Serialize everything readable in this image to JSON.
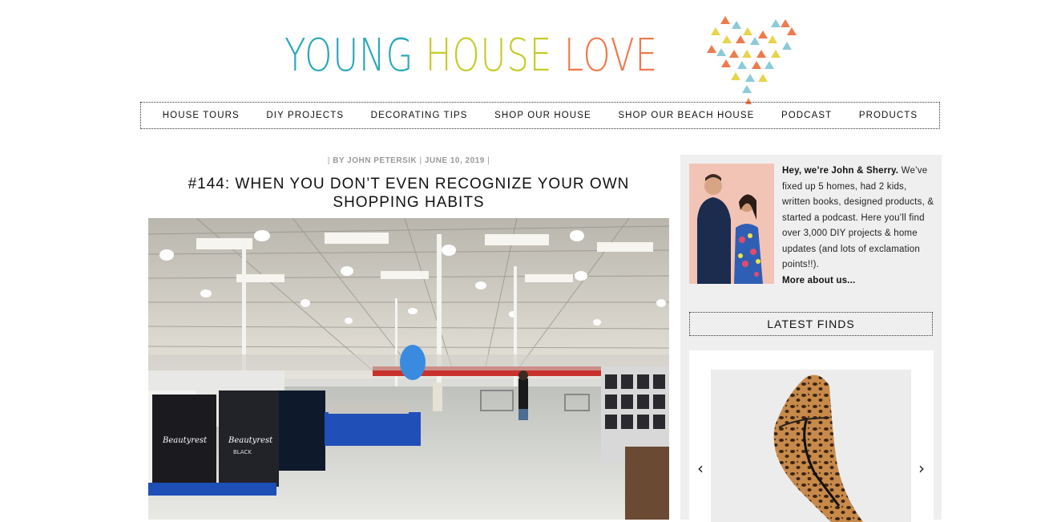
{
  "header": {
    "logo": {
      "word1": "YOUNG",
      "word2": "HOUSE",
      "word3": "LOVE",
      "color1": "#2aa8b8",
      "color2": "#c4cc2a",
      "color3": "#ee7a4d"
    }
  },
  "nav": {
    "items": [
      {
        "label": "HOUSE TOURS"
      },
      {
        "label": "DIY PROJECTS"
      },
      {
        "label": "DECORATING TIPS"
      },
      {
        "label": "SHOP OUR HOUSE"
      },
      {
        "label": "SHOP OUR BEACH HOUSE"
      },
      {
        "label": "PODCAST"
      },
      {
        "label": "PRODUCTS"
      }
    ]
  },
  "post": {
    "separator": "|",
    "author": "BY JOHN PETERSIK",
    "date": "JUNE 10, 2019",
    "title": "#144: WHEN YOU DON’T EVEN RECOGNIZE YOUR OWN SHOPPING HABITS",
    "image_icon": "warehouse-store-photo"
  },
  "sidebar": {
    "about": {
      "greeting": "Hey, we’re John & Sherry.",
      "body": "We’ve fixed up 5 homes, had 2 kids, written books, designed products, & started a podcast. Here you’ll find over 3,000 DIY projects & home updates (and lots of exclamation points!!).",
      "more_link": "More about us..."
    },
    "latest_finds": {
      "heading": "LATEST FINDS",
      "prev_icon": "chevron-left-icon",
      "next_icon": "chevron-right-icon",
      "prev_glyph": "‹",
      "next_glyph": "›"
    }
  }
}
